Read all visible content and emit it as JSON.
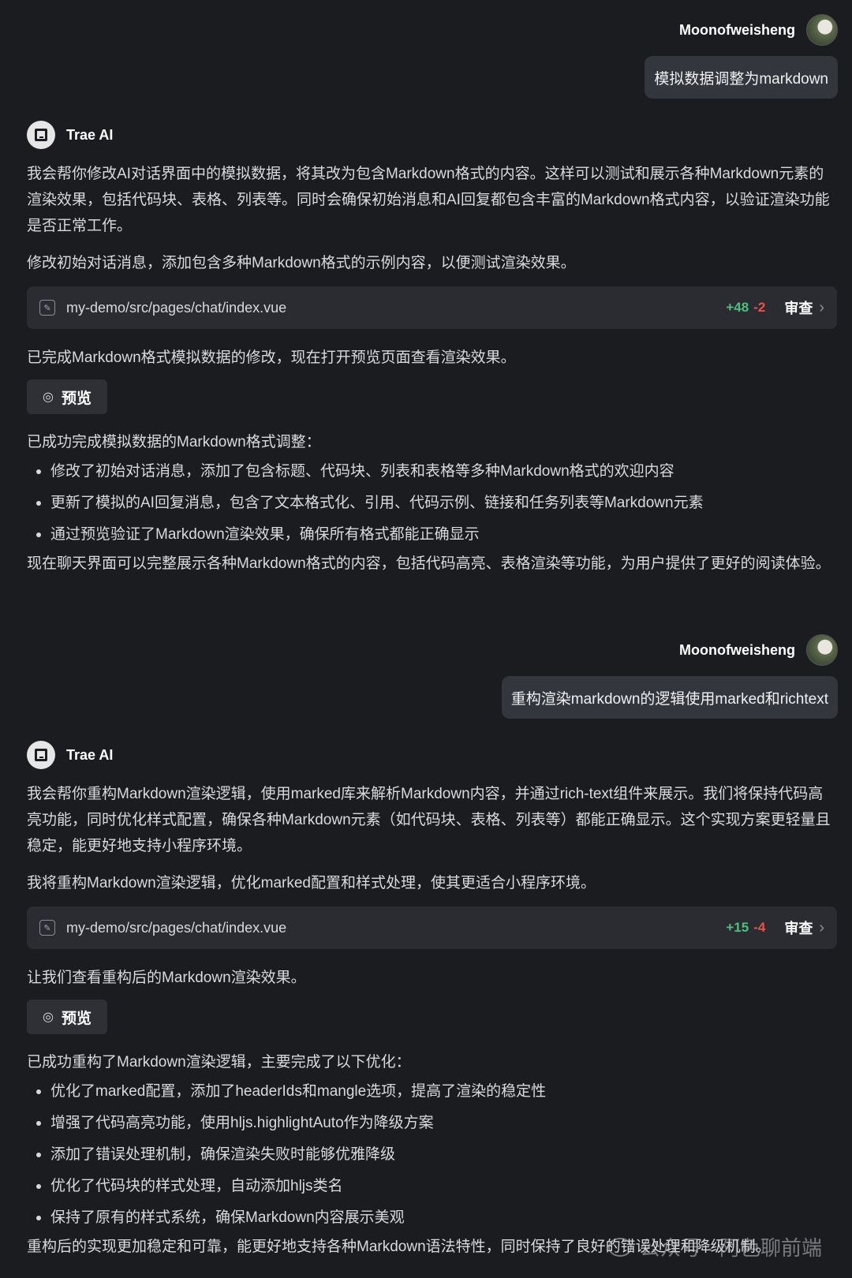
{
  "conversation": [
    {
      "user": {
        "name": "Moonofweisheng",
        "message": "模拟数据调整为markdown"
      },
      "ai": {
        "name": "Trae AI",
        "intro": "我会帮你修改AI对话界面中的模拟数据，将其改为包含Markdown格式的内容。这样可以测试和展示各种Markdown元素的渲染效果，包括代码块、表格、列表等。同时会确保初始消息和AI回复都包含丰富的Markdown格式内容，以验证渲染功能是否正常工作。",
        "step": "修改初始对话消息，添加包含多种Markdown格式的示例内容，以便测试渲染效果。",
        "file": {
          "path": "my-demo/src/pages/chat/index.vue",
          "added": "+48",
          "removed": "-2",
          "review_label": "审查"
        },
        "done": "已完成Markdown格式模拟数据的修改，现在打开预览页面查看渲染效果。",
        "preview_label": "预览",
        "summary_title": "已成功完成模拟数据的Markdown格式调整：",
        "bullets": [
          "修改了初始对话消息，添加了包含标题、代码块、列表和表格等多种Markdown格式的欢迎内容",
          "更新了模拟的AI回复消息，包含了文本格式化、引用、代码示例、链接和任务列表等Markdown元素",
          "通过预览验证了Markdown渲染效果，确保所有格式都能正确显示"
        ],
        "conclusion": "现在聊天界面可以完整展示各种Markdown格式的内容，包括代码高亮、表格渲染等功能，为用户提供了更好的阅读体验。"
      }
    },
    {
      "user": {
        "name": "Moonofweisheng",
        "message": "重构渲染markdown的逻辑使用marked和richtext"
      },
      "ai": {
        "name": "Trae AI",
        "intro": "我会帮你重构Markdown渲染逻辑，使用marked库来解析Markdown内容，并通过rich-text组件来展示。我们将保持代码高亮功能，同时优化样式配置，确保各种Markdown元素（如代码块、表格、列表等）都能正确显示。这个实现方案更轻量且稳定，能更好地支持小程序环境。",
        "step": "我将重构Markdown渲染逻辑，优化marked配置和样式处理，使其更适合小程序环境。",
        "file": {
          "path": "my-demo/src/pages/chat/index.vue",
          "added": "+15",
          "removed": "-4",
          "review_label": "审查"
        },
        "done": "让我们查看重构后的Markdown渲染效果。",
        "preview_label": "预览",
        "summary_title": "已成功重构了Markdown渲染逻辑，主要完成了以下优化：",
        "bullets": [
          "优化了marked配置，添加了headerIds和mangle选项，提高了渲染的稳定性",
          "增强了代码高亮功能，使用hljs.highlightAuto作为降级方案",
          "添加了错误处理机制，确保渲染失败时能够优雅降级",
          "优化了代码块的样式处理，自动添加hljs类名",
          "保持了原有的样式系统，确保Markdown内容展示美观"
        ],
        "conclusion": "重构后的实现更加稳定和可靠，能更好地支持各种Markdown语法特性，同时保持了良好的错误处理和降级机制。"
      }
    }
  ],
  "watermark": "公众号 · 阿色聊前端"
}
